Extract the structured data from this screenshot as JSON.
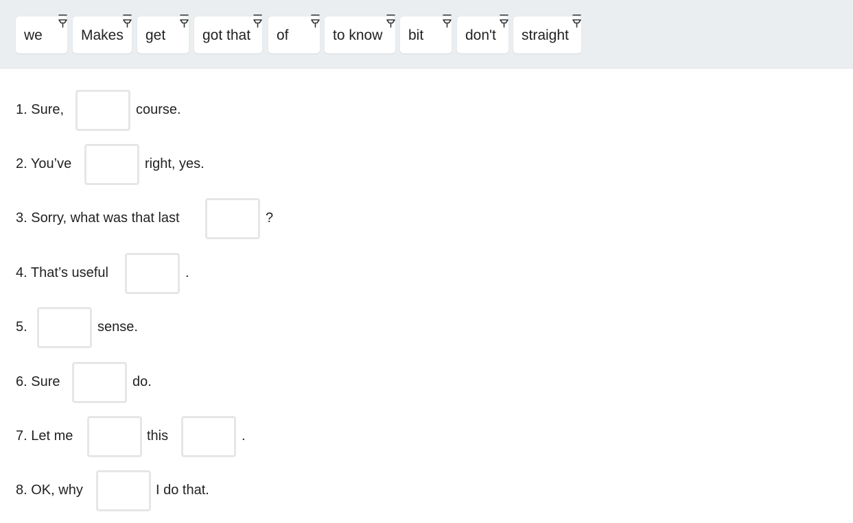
{
  "word_bank": [
    {
      "label": "we"
    },
    {
      "label": "Makes"
    },
    {
      "label": "get"
    },
    {
      "label": "got that"
    },
    {
      "label": "of"
    },
    {
      "label": "to know"
    },
    {
      "label": "bit"
    },
    {
      "label": "don't"
    },
    {
      "label": "straight"
    }
  ],
  "questions": [
    {
      "before": "1. Sure,",
      "after": "course."
    },
    {
      "before": "2. You’ve",
      "after": "right, yes."
    },
    {
      "before": "3. Sorry, what was that last",
      "after": "?"
    },
    {
      "before": "4. That’s useful",
      "after": "."
    },
    {
      "before": "5.",
      "after": "sense."
    },
    {
      "before": "6. Sure",
      "after": "do."
    },
    {
      "before": "7. Let me",
      "middle": "this",
      "after": "."
    },
    {
      "before": "8. OK, why",
      "after": "I do that."
    }
  ]
}
